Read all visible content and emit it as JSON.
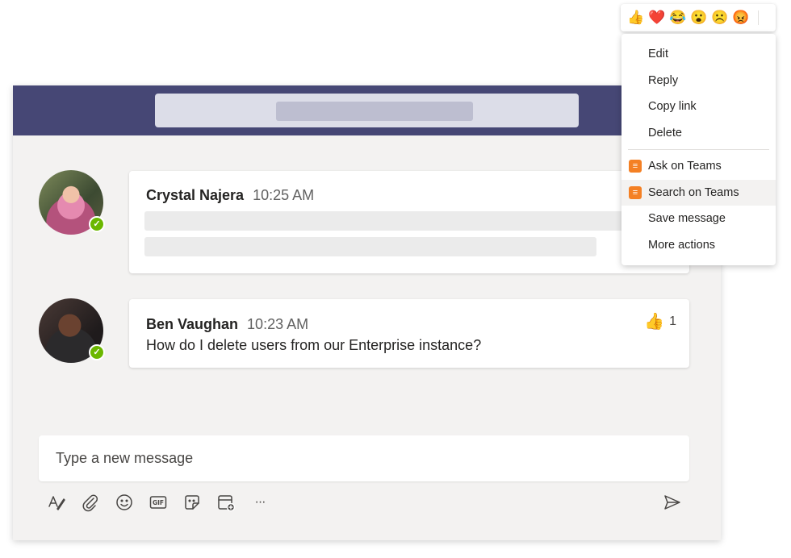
{
  "messages": [
    {
      "author": "Crystal Najera",
      "time": "10:25 AM",
      "status": "available"
    },
    {
      "author": "Ben Vaughan",
      "time": "10:23 AM",
      "text": "How do I delete users from our Enterprise instance?",
      "status": "available",
      "reaction": {
        "icon": "thumbs-up",
        "emoji": "👍",
        "count": "1"
      }
    }
  ],
  "compose": {
    "placeholder": "Type a new message"
  },
  "toolbar": {
    "icons": [
      "format-icon",
      "attach-icon",
      "emoji-icon",
      "gif-icon",
      "sticker-icon",
      "meeting-icon",
      "more-icon"
    ],
    "more_label": "···",
    "send_icon": "send-icon"
  },
  "reactions": [
    {
      "name": "like",
      "emoji": "👍"
    },
    {
      "name": "heart",
      "emoji": "❤️"
    },
    {
      "name": "laugh",
      "emoji": "😂"
    },
    {
      "name": "surprised",
      "emoji": "😮"
    },
    {
      "name": "sad",
      "emoji": "☹️"
    },
    {
      "name": "angry",
      "emoji": "😡"
    }
  ],
  "menu": {
    "items": [
      {
        "label": "Edit"
      },
      {
        "label": "Reply"
      },
      {
        "label": "Copy link"
      },
      {
        "label": "Delete"
      }
    ],
    "app_items": [
      {
        "label": "Ask on Teams",
        "icon": "stackoverflow-icon"
      },
      {
        "label": "Search on Teams",
        "icon": "stackoverflow-icon",
        "hovered": true
      },
      {
        "label": "Save message"
      },
      {
        "label": "More actions"
      }
    ]
  },
  "colors": {
    "titlebar": "#464775",
    "presence": "#6bb700",
    "app_icon": "#f48024",
    "canvas": "#f3f2f1"
  }
}
